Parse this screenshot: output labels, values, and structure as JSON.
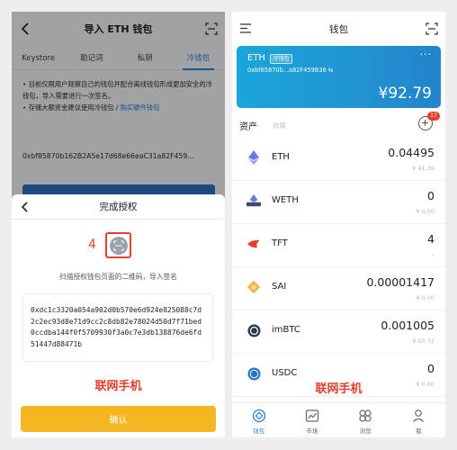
{
  "left": {
    "header_title": "导入 ETH 钱包",
    "tabs": [
      {
        "label": "Keystore"
      },
      {
        "label": "助记词"
      },
      {
        "label": "私钥"
      },
      {
        "label": "冷钱包"
      }
    ],
    "note_line1": "• 目前仅限用户观察自己的钱包并配合离线钱包形成更加安全的冷钱包，导入需要进行一次签名。",
    "note_line2_prefix": "• 存储大额资金建议使用冷钱包 / ",
    "note_line2_link": "购买硬件钱包",
    "address": "0xbf85870b162B2A5e17d68e66eaC31a82F459...",
    "sheet_title": "完成授权",
    "step_number": "4",
    "scan_hint": "扫描授权钱包页面的二维码，导入签名",
    "signature": "0xdc1c3320a054a902d0b570e6d924e825088c7d2c2ec93d8e71d9cc2c8db82e78024d50d7f71bed0ccdba144f0f5709930f3a0c7e3db138876de6fd51447d88471b",
    "red_label": "联网手机",
    "confirm_label": "确认"
  },
  "right": {
    "header_title": "钱包",
    "wallet": {
      "name": "ETH",
      "tag": "冷钱包",
      "address": "0xbf85870b...a82F459B36",
      "copy_glyph": "⇆",
      "more_glyph": "···",
      "balance": "¥92.79"
    },
    "assets_title": "资产",
    "collect_label": "收藏",
    "badge_count": "17",
    "assets": [
      {
        "symbol": "ETH",
        "amount": "0.04495",
        "value": "¥ 41.36",
        "icon": "eth-icon"
      },
      {
        "symbol": "WETH",
        "amount": "0",
        "value": "¥ 0.00",
        "icon": "weth-icon"
      },
      {
        "symbol": "TFT",
        "amount": "4",
        "value": "–",
        "icon": "tft-icon"
      },
      {
        "symbol": "SAI",
        "amount": "0.00001417",
        "value": "¥ 0.00",
        "icon": "sai-icon"
      },
      {
        "symbol": "imBTC",
        "amount": "0.001005",
        "value": "¥ 50.72",
        "icon": "imbtc-icon"
      },
      {
        "symbol": "USDC",
        "amount": "0",
        "value": "¥ 0.00",
        "icon": "usdc-icon"
      }
    ],
    "red_label": "联网手机",
    "tabbar": [
      {
        "label": "钱包",
        "icon": "wallet-icon"
      },
      {
        "label": "市场",
        "icon": "market-icon"
      },
      {
        "label": "浏览",
        "icon": "browse-icon"
      },
      {
        "label": "我",
        "icon": "profile-icon"
      }
    ]
  },
  "colors": {
    "accent_blue": "#2f7ed8",
    "highlight_red": "#e4402b",
    "confirm_yellow": "#f5b720"
  }
}
